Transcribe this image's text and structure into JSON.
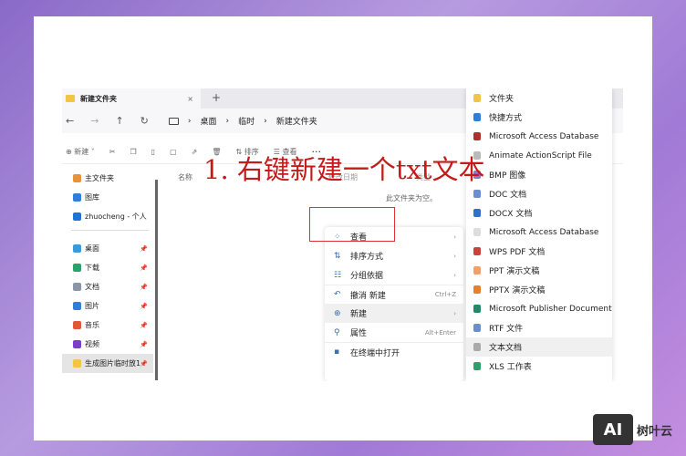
{
  "tab": {
    "title": "新建文件夹",
    "close": "×",
    "new_tab": "+"
  },
  "nav": {
    "back": "←",
    "forward": "→",
    "up": "↑",
    "refresh": "↻",
    "breadcrumb": [
      "桌面",
      "临时",
      "新建文件夹"
    ],
    "sep": "›"
  },
  "toolbar": {
    "new": "新建",
    "sort": "排序",
    "view": "查看",
    "more": "···"
  },
  "sidebar": {
    "items": [
      {
        "label": "主文件夹",
        "color": "#e8923a"
      },
      {
        "label": "图库",
        "color": "#2f7fd9"
      },
      {
        "label": "zhuocheng - 个人",
        "color": "#1e74d0"
      },
      {
        "label": "桌面",
        "color": "#3a9ad9",
        "pin": true
      },
      {
        "label": "下载",
        "color": "#2aa36b",
        "pin": true
      },
      {
        "label": "文档",
        "color": "#8a95a5",
        "pin": true
      },
      {
        "label": "图片",
        "color": "#2f7fd9",
        "pin": true
      },
      {
        "label": "音乐",
        "color": "#e0583a",
        "pin": true
      },
      {
        "label": "视频",
        "color": "#7b3fd0",
        "pin": true
      },
      {
        "label": "生成图片临时放1",
        "color": "#f4c542",
        "pin": true
      }
    ]
  },
  "columns": [
    "名称",
    "修改日期",
    "类型"
  ],
  "empty_text": "此文件夹为空。",
  "context_menu": [
    {
      "label": "查看",
      "icon": "grid-icon",
      "arrow": "›"
    },
    {
      "label": "排序方式",
      "icon": "sort-icon",
      "arrow": "›"
    },
    {
      "label": "分组依据",
      "icon": "group-icon",
      "arrow": "›"
    },
    {
      "label": "撤消 新建",
      "icon": "undo-icon",
      "shortcut": "Ctrl+Z"
    },
    {
      "label": "新建",
      "icon": "plus-circle-icon",
      "arrow": "›"
    },
    {
      "label": "属性",
      "icon": "wrench-icon",
      "shortcut": "Alt+Enter"
    },
    {
      "label": "在终端中打开",
      "icon": "terminal-icon"
    }
  ],
  "submenu": [
    {
      "label": "文件夹",
      "color": "#f4c542"
    },
    {
      "label": "快捷方式",
      "color": "#2f7fd9"
    },
    {
      "label": "Microsoft Access Database",
      "color": "#b0302a"
    },
    {
      "label": "Animate ActionScript File",
      "color": "#bbbbbb"
    },
    {
      "label": "BMP 图像",
      "color": "#8a78c8"
    },
    {
      "label": "DOC 文档",
      "color": "#6a8fd0"
    },
    {
      "label": "DOCX 文档",
      "color": "#2f6fd0"
    },
    {
      "label": "Microsoft Access Database",
      "color": "#dddddd"
    },
    {
      "label": "WPS PDF 文档",
      "color": "#d0403a"
    },
    {
      "label": "PPT 演示文稿",
      "color": "#f0a070"
    },
    {
      "label": "PPTX 演示文稿",
      "color": "#e8802a"
    },
    {
      "label": "Microsoft Publisher Document",
      "color": "#1f8a6a"
    },
    {
      "label": "RTF 文件",
      "color": "#6a8fd0"
    },
    {
      "label": "文本文档",
      "color": "#aaaaaa"
    },
    {
      "label": "XLS 工作表",
      "color": "#2aa36b"
    }
  ],
  "annotation": "1. 右键新建一个txt文本",
  "watermark": {
    "box": "AI",
    "text": "树叶云"
  }
}
